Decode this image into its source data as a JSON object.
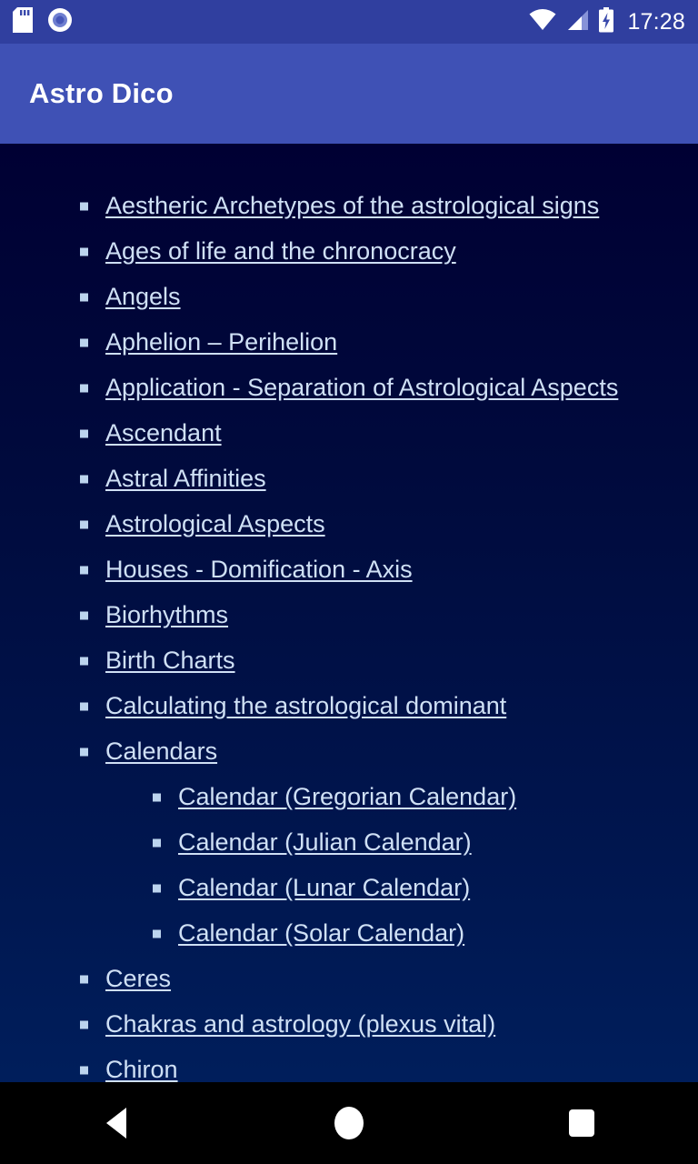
{
  "status_bar": {
    "icons_left": [
      "sd-card-icon",
      "record-circle-icon"
    ],
    "icons_right": [
      "wifi-icon",
      "cell-signal-icon",
      "battery-charging-icon"
    ],
    "time": "17:28",
    "background_color": "#303f9f"
  },
  "app_bar": {
    "title": "Astro Dico",
    "background_color": "#3f51b5",
    "title_color": "#ffffff"
  },
  "content": {
    "link_color": "#cfe0f5",
    "bullet_color": "#bcd4ee",
    "background_top_color": "#000033",
    "background_bottom_color": "#002160",
    "items": [
      {
        "label": "Aestheric Archetypes of the astrological signs",
        "level": 1
      },
      {
        "label": "Ages of life and the chronocracy",
        "level": 1
      },
      {
        "label": "Angels",
        "level": 1
      },
      {
        "label": "Aphelion – Perihelion",
        "level": 1
      },
      {
        "label": "Application - Separation of Astrological Aspects",
        "level": 1
      },
      {
        "label": "Ascendant",
        "level": 1
      },
      {
        "label": "Astral Affinities",
        "level": 1
      },
      {
        "label": "Astrological Aspects",
        "level": 1
      },
      {
        "label": "Houses - Domification - Axis",
        "level": 1
      },
      {
        "label": "Biorhythms",
        "level": 1
      },
      {
        "label": "Birth Charts",
        "level": 1
      },
      {
        "label": "Calculating the astrological dominant",
        "level": 1
      },
      {
        "label": "Calendars",
        "level": 1
      },
      {
        "label": "Calendar (Gregorian Calendar)",
        "level": 2
      },
      {
        "label": "Calendar (Julian Calendar)",
        "level": 2
      },
      {
        "label": "Calendar (Lunar Calendar)",
        "level": 2
      },
      {
        "label": "Calendar (Solar Calendar)",
        "level": 2
      },
      {
        "label": "Ceres",
        "level": 1
      },
      {
        "label": "Chakras and astrology (plexus vital)",
        "level": 1
      },
      {
        "label": "Chiron",
        "level": 1
      }
    ]
  },
  "nav_bar": {
    "background_color": "#000000",
    "buttons": [
      {
        "name": "back-button",
        "icon": "triangle-left-icon"
      },
      {
        "name": "home-button",
        "icon": "circle-icon"
      },
      {
        "name": "recents-button",
        "icon": "square-icon"
      }
    ]
  }
}
